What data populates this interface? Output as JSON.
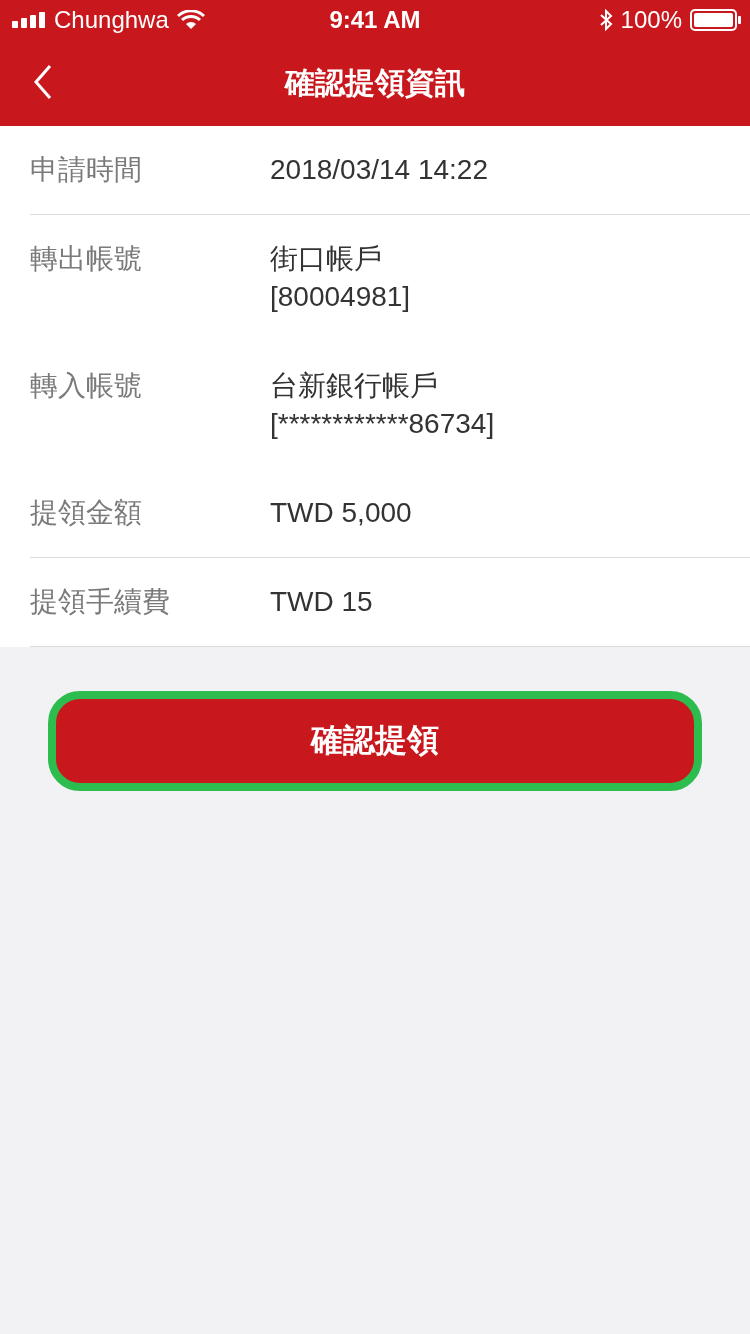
{
  "status_bar": {
    "carrier": "Chunghwa",
    "time": "9:41 AM",
    "battery": "100%"
  },
  "header": {
    "title": "確認提領資訊"
  },
  "rows": [
    {
      "label": "申請時間",
      "value": [
        "2018/03/14 14:22"
      ],
      "divider": true
    },
    {
      "label": "轉出帳號",
      "value": [
        "街口帳戶",
        "[80004981]"
      ],
      "divider": false
    },
    {
      "label": "轉入帳號",
      "value": [
        "台新銀行帳戶",
        "[************86734]"
      ],
      "divider": false
    },
    {
      "label": "提領金額",
      "value": [
        "TWD 5,000"
      ],
      "divider": true
    },
    {
      "label": "提領手續費",
      "value": [
        "TWD 15"
      ],
      "divider": true
    }
  ],
  "confirm_button": {
    "label": "確認提領",
    "highlighted": true
  }
}
